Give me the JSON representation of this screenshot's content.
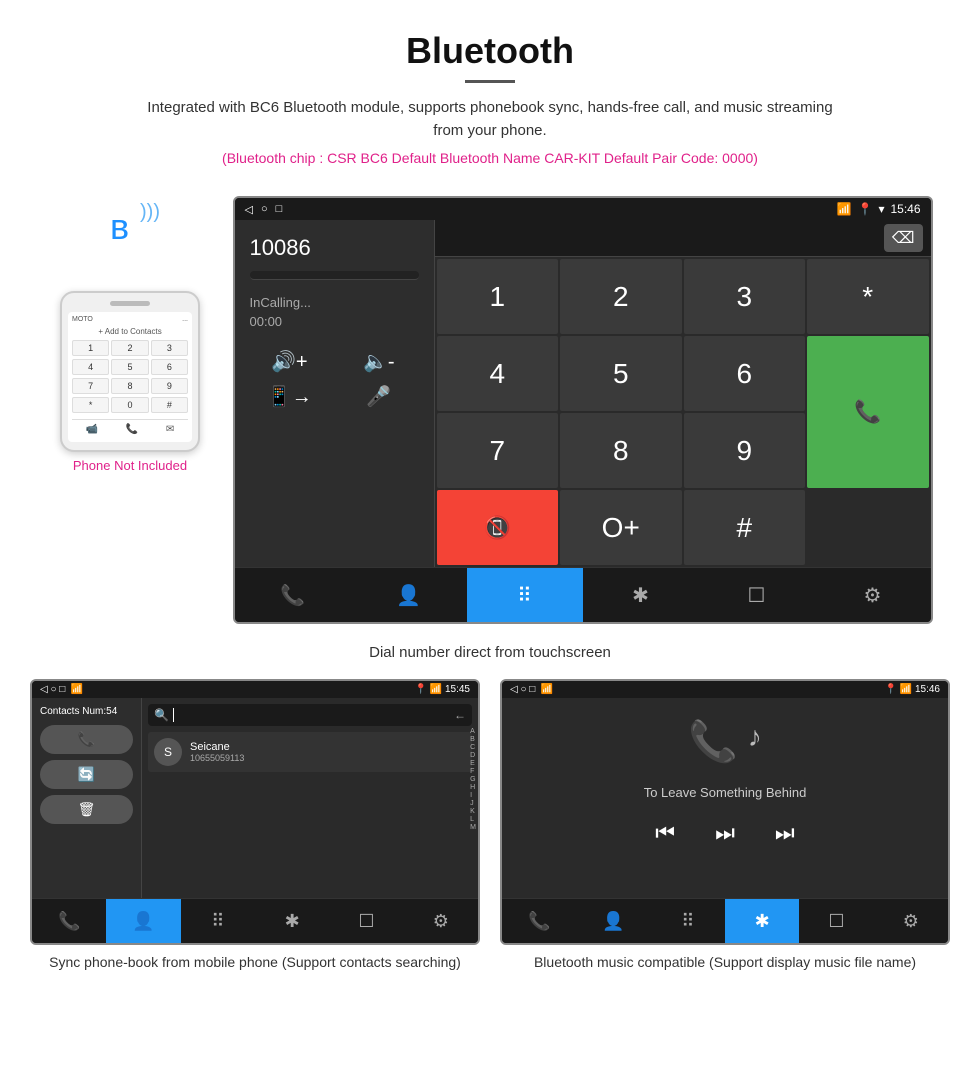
{
  "header": {
    "title": "Bluetooth",
    "description": "Integrated with BC6 Bluetooth module, supports phonebook sync, hands-free call, and music streaming from your phone.",
    "specs": "(Bluetooth chip : CSR BC6    Default Bluetooth Name CAR-KIT    Default Pair Code: 0000)"
  },
  "dial_screen": {
    "status_bar": {
      "left_icons": [
        "◁",
        "○",
        "□"
      ],
      "right_icons": [
        "📞",
        "📍",
        "📶"
      ],
      "time": "15:46"
    },
    "number": "10086",
    "status": "InCalling...",
    "timer": "00:00",
    "keys": [
      "1",
      "2",
      "3",
      "*",
      "4",
      "5",
      "6",
      "O+",
      "7",
      "8",
      "9",
      "#"
    ],
    "call_green": "📞",
    "call_red": "📞",
    "nav_items": [
      "📞",
      "👤",
      "⠿",
      "✱",
      "☐",
      "⚙"
    ]
  },
  "caption_main": "Dial number direct from touchscreen",
  "phone_not_included": "Phone Not Included",
  "contacts_screen": {
    "status_bar_time": "15:45",
    "contacts_num": "Contacts Num:54",
    "contact_name": "Seicane",
    "contact_phone": "10655059113",
    "alpha_letters": [
      "A",
      "B",
      "C",
      "D",
      "E",
      "F",
      "G",
      "H",
      "I",
      "J",
      "K",
      "L",
      "M"
    ]
  },
  "music_screen": {
    "status_bar_time": "15:46",
    "song_title": "To Leave Something Behind"
  },
  "bottom_captions": {
    "contacts": "Sync phone-book from mobile phone\n(Support contacts searching)",
    "music": "Bluetooth music compatible\n(Support display music file name)"
  }
}
